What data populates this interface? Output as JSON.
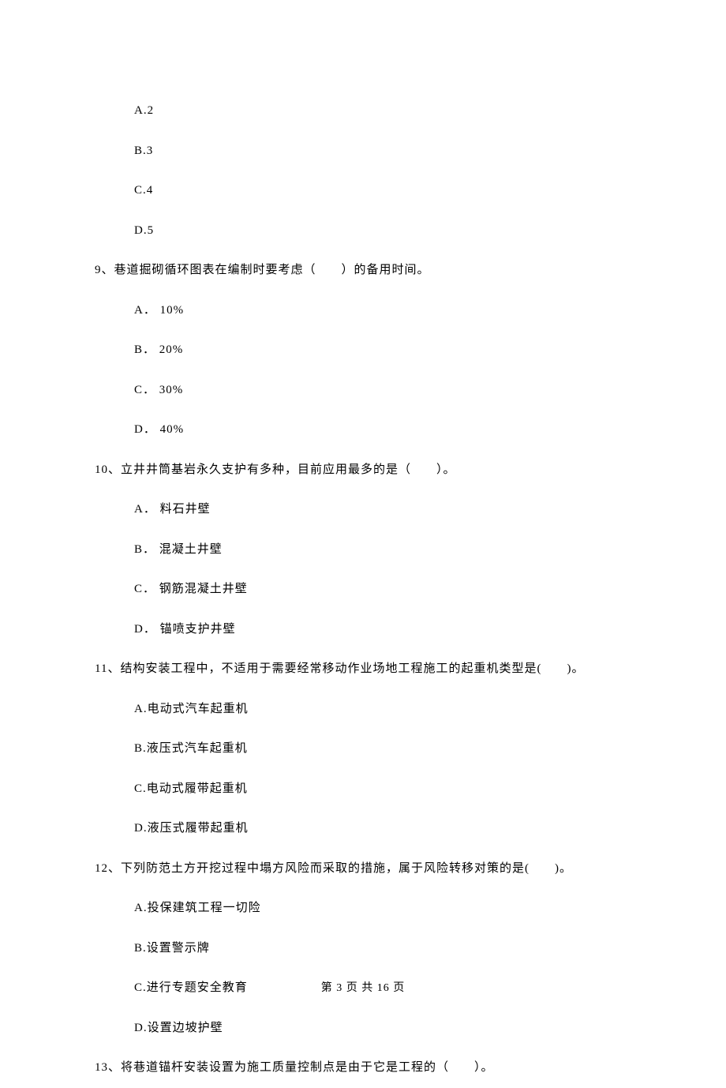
{
  "q8_prefix": {
    "options": {
      "a": "A.2",
      "b": "B.3",
      "c": "C.4",
      "d": "D.5"
    }
  },
  "q9": {
    "text": "9、巷道掘砌循环图表在编制时要考虑（　　）的备用时间。",
    "options": {
      "a": "A． 10%",
      "b": "B． 20%",
      "c": "C． 30%",
      "d": "D． 40%"
    }
  },
  "q10": {
    "text": "10、立井井筒基岩永久支护有多种，目前应用最多的是（　　）。",
    "options": {
      "a": "A． 料石井壁",
      "b": "B． 混凝土井壁",
      "c": "C． 钢筋混凝土井壁",
      "d": "D． 锚喷支护井壁"
    }
  },
  "q11": {
    "text": "11、结构安装工程中，不适用于需要经常移动作业场地工程施工的起重机类型是(　　)。",
    "options": {
      "a": "A.电动式汽车起重机",
      "b": "B.液压式汽车起重机",
      "c": "C.电动式履带起重机",
      "d": "D.液压式履带起重机"
    }
  },
  "q12": {
    "text": "12、下列防范土方开挖过程中塌方风险而采取的措施，属于风险转移对策的是(　　)。",
    "options": {
      "a": "A.投保建筑工程一切险",
      "b": "B.设置警示牌",
      "c": "C.进行专题安全教育",
      "d": "D.设置边坡护壁"
    }
  },
  "q13": {
    "text": "13、将巷道锚杆安装设置为施工质量控制点是由于它是工程的（　　）。"
  },
  "footer": "第 3 页 共 16 页"
}
